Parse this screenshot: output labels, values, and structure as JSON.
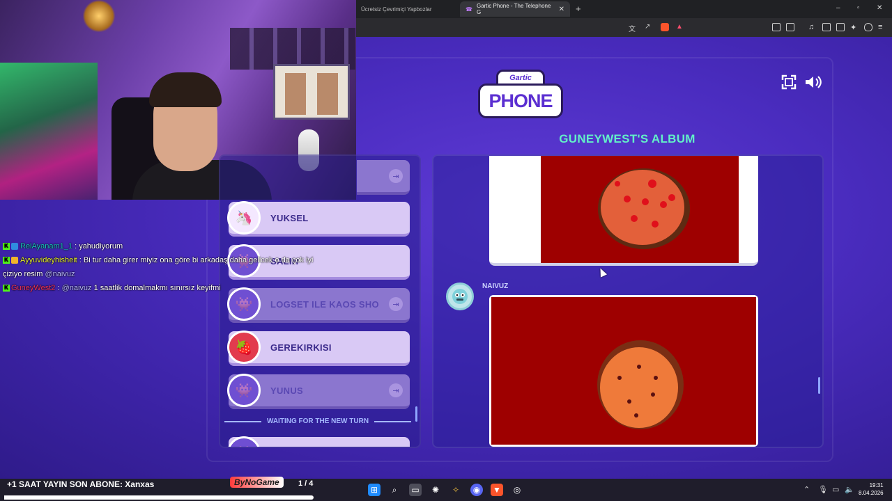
{
  "browser": {
    "tabs": [
      {
        "label": "Ücretsiz Çevrimiçi Yapbozlar",
        "active": false
      },
      {
        "label": "Gartic Phone - The Telephone G",
        "active": true
      }
    ],
    "new_tab": "+",
    "window_controls": {
      "minimize": "–",
      "maximize": "▫",
      "close": "✕"
    }
  },
  "game": {
    "logo_top": "Gartic",
    "logo_bottom": "PHONE",
    "album_title": "GUNEYWEST'S ALBUM",
    "players": [
      {
        "name": "",
        "state": "dim",
        "avatar_icon": "exit-icon"
      },
      {
        "name": "YUKSEL",
        "state": "active",
        "avatar_icon": "unicorn-avatar-icon"
      },
      {
        "name": "SALIH",
        "state": "active",
        "avatar_icon": "alien-avatar-icon"
      },
      {
        "name": "LOGSET ILE KAOS SHO",
        "state": "dim",
        "avatar_icon": "monster-avatar-icon"
      },
      {
        "name": "GEREKIRKISI",
        "state": "active",
        "avatar_icon": "strawberry-avatar-icon"
      },
      {
        "name": "YUNUS",
        "state": "dim",
        "avatar_icon": "monster-avatar-icon"
      }
    ],
    "waiting_text": "WAITING FOR THE NEW TURN",
    "entry_author": "NAIVUZ"
  },
  "chat": [
    {
      "user": "ReiAyanam1_1",
      "text": ": yahudiyorum",
      "color": "#18c9c0"
    },
    {
      "user": "Ayyuvideyhisheit",
      "text": ": Bi tur daha girer miyiz ona göre bi arkadaş daha gelicek o da çok iyi çiziyo resim",
      "mention": "@naivuz",
      "color": "#e7ef2a"
    },
    {
      "user": "GuneyWest2",
      "mention": "@naivuz",
      "text": "1 saatlik domalmakmı sınırsız keyifmi",
      "color": "#f0315e"
    }
  ],
  "overlay": {
    "ticker": "+1 SAAT YAYIN  SON ABONE: Xanxas",
    "sponsor": "ByNoGame",
    "page_indicator": "1 / 4",
    "progress": 0.27
  },
  "taskbar": {
    "time": "19:31",
    "date": "8.04.2026"
  }
}
